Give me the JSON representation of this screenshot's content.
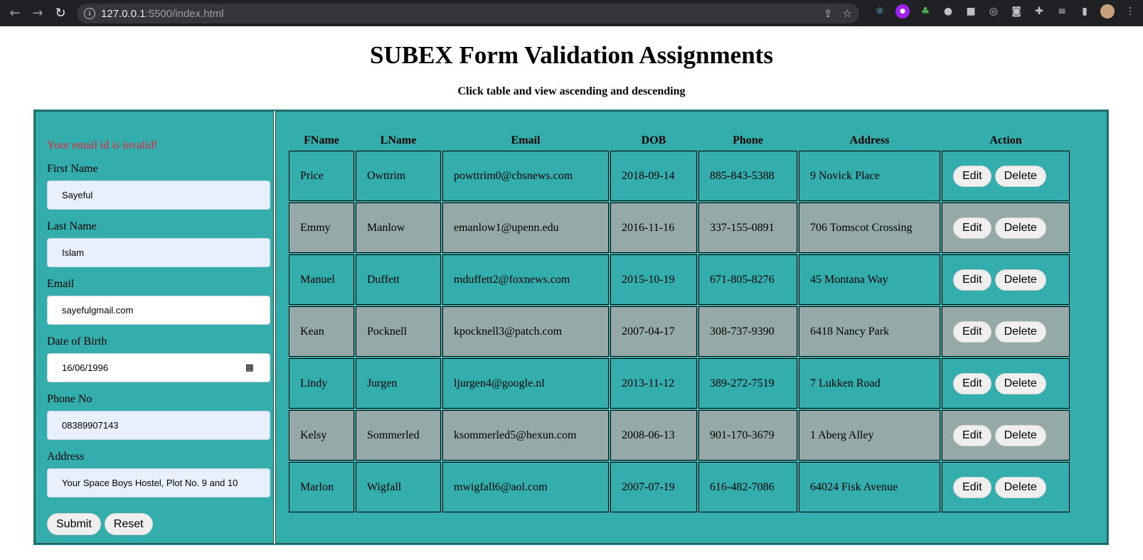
{
  "browser": {
    "url_host": "127.0.0.1",
    "url_path": ":5500/index.html"
  },
  "page": {
    "title": "SUBEX Form Validation Assignments",
    "subtitle": "Click table and view ascending and descending"
  },
  "form": {
    "error": "Your email id is invalid!",
    "first_name_label": "First Name",
    "first_name_value": "Sayeful",
    "last_name_label": "Last Name",
    "last_name_value": "Islam",
    "email_label": "Email",
    "email_value": "sayefulgmail.com",
    "dob_label": "Date of Birth",
    "dob_value": "16/06/1996",
    "phone_label": "Phone No",
    "phone_value": "08389907143",
    "address_label": "Address",
    "address_value": "Your Space Boys Hostel, Plot No. 9 and 10",
    "submit_label": "Submit",
    "reset_label": "Reset"
  },
  "table": {
    "headers": [
      "FName",
      "LName",
      "Email",
      "DOB",
      "Phone",
      "Address",
      "Action"
    ],
    "edit_label": "Edit",
    "delete_label": "Delete",
    "rows": [
      [
        "Price",
        "Owttrim",
        "powttrim0@cbsnews.com",
        "2018-09-14",
        "885-843-5388",
        "9 Novick Place"
      ],
      [
        "Emmy",
        "Manlow",
        "emanlow1@upenn.edu",
        "2016-11-16",
        "337-155-0891",
        "706 Tomscot Crossing"
      ],
      [
        "Manuel",
        "Duffett",
        "mduffett2@foxnews.com",
        "2015-10-19",
        "671-805-8276",
        "45 Montana Way"
      ],
      [
        "Kean",
        "Pocknell",
        "kpocknell3@patch.com",
        "2007-04-17",
        "308-737-9390",
        "6418 Nancy Park"
      ],
      [
        "Lindy",
        "Jurgen",
        "ljurgen4@google.nl",
        "2013-11-12",
        "389-272-7519",
        "7 Lukken Road"
      ],
      [
        "Kelsy",
        "Sommerled",
        "ksommerled5@hexun.com",
        "2008-06-13",
        "901-170-3679",
        "1 Aberg Alley"
      ],
      [
        "Marlon",
        "Wigfall",
        "mwigfall6@aol.com",
        "2007-07-19",
        "616-482-7086",
        "64024 Fisk Avenue"
      ]
    ]
  }
}
